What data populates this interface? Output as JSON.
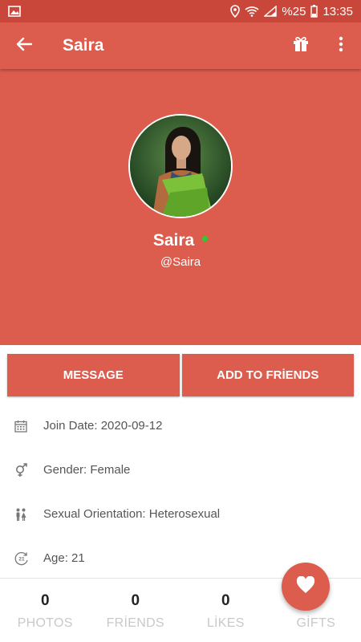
{
  "status_bar": {
    "battery_percent": "%25",
    "time": "13:35"
  },
  "toolbar": {
    "title": "Saira"
  },
  "profile": {
    "name": "Saira",
    "username": "@Saira",
    "online": true
  },
  "actions": {
    "message_label": "MESSAGE",
    "add_friends_label": "ADD TO FRİENDS"
  },
  "info": {
    "join_date": "Join Date: 2020-09-12",
    "gender": "Gender: Female",
    "orientation": "Sexual Orientation: Heterosexual",
    "age": "Age: 21",
    "age_icon_text": "21"
  },
  "stats": {
    "photos": {
      "count": "0",
      "label": "PHOTOS"
    },
    "friends": {
      "count": "0",
      "label": "FRİENDS"
    },
    "likes": {
      "count": "0",
      "label": "LİKES"
    },
    "gifts": {
      "count": "",
      "label": "GİFTS"
    }
  },
  "colors": {
    "primary": "#dc5c4d",
    "status_bar": "#c9473a",
    "online": "#2ec934"
  },
  "icons": [
    "image-icon",
    "location-icon",
    "wifi-icon",
    "signal-icon",
    "battery-icon",
    "back-arrow-icon",
    "gift-icon",
    "more-vert-icon",
    "calendar-icon",
    "gender-icon",
    "people-icon",
    "age-icon",
    "heart-icon"
  ]
}
